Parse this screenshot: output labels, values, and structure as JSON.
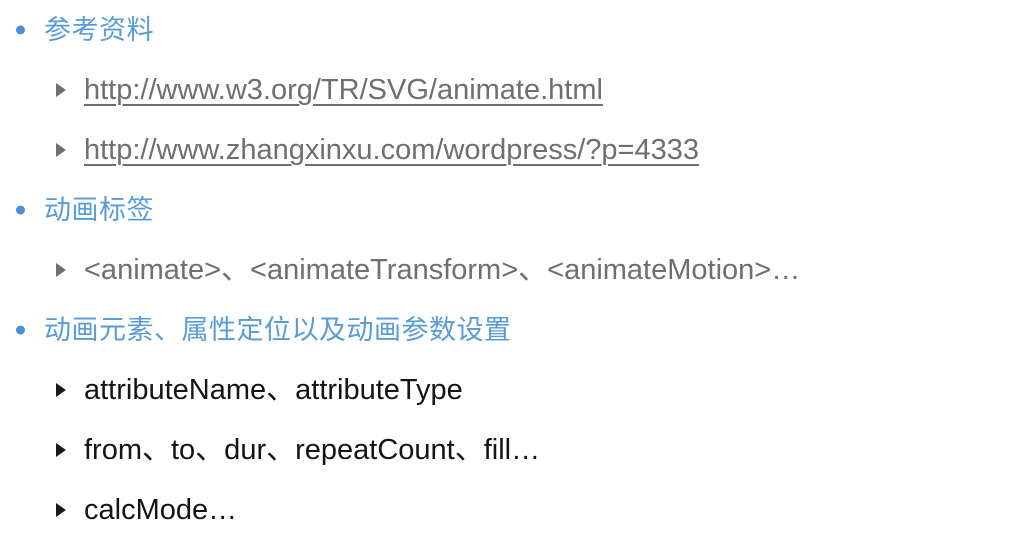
{
  "slide": {
    "background_color": "#ffffff",
    "accent_color": "#5B9BD5",
    "muted_text_color": "#6E6E73",
    "dark_text_color": "#141414",
    "bullets": [
      {
        "level": 1,
        "label": "参考资料",
        "marker": "round-bullet"
      },
      {
        "level": 2,
        "label": "http://www.w3.org/TR/SVG/animate.html",
        "marker": "triangle-bullet",
        "style": "hyperlink"
      },
      {
        "level": 2,
        "label": "http://www.zhangxinxu.com/wordpress/?p=4333",
        "marker": "triangle-bullet",
        "style": "hyperlink"
      },
      {
        "level": 1,
        "label": "动画标签",
        "marker": "round-bullet"
      },
      {
        "level": 2,
        "label": "<animate>、<animateTransform>、<animateMotion>…",
        "marker": "triangle-bullet",
        "style": "muted"
      },
      {
        "level": 1,
        "label": "动画元素、属性定位以及动画参数设置",
        "marker": "round-bullet"
      },
      {
        "level": 2,
        "label": "attributeName、attributeType",
        "marker": "triangle-bullet",
        "style": "dark"
      },
      {
        "level": 2,
        "label": "from、to、dur、repeatCount、fill…",
        "marker": "triangle-bullet",
        "style": "dark"
      },
      {
        "level": 2,
        "label": "calcMode…",
        "marker": "triangle-bullet",
        "style": "dark"
      }
    ]
  }
}
